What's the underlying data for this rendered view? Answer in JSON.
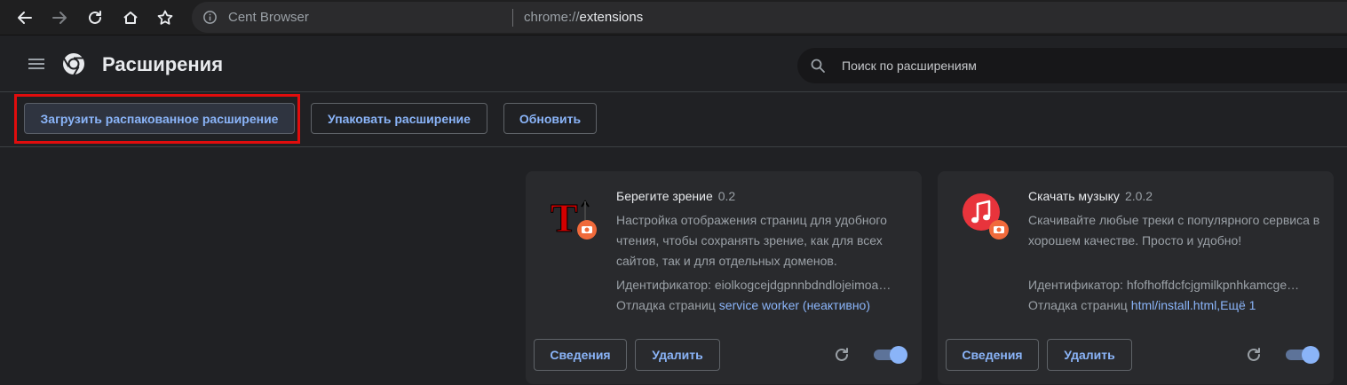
{
  "browser": {
    "site_name": "Cent Browser",
    "url_scheme": "chrome://",
    "url_host": "extensions"
  },
  "header": {
    "title": "Расширения",
    "search_placeholder": "Поиск по расширениям"
  },
  "toolbar": {
    "load_unpacked": "Загрузить распакованное расширение",
    "pack": "Упаковать расширение",
    "update": "Обновить"
  },
  "extensions": [
    {
      "name": "Берегите зрение",
      "version": "0.2",
      "description": "Настройка отображения страниц для удобного чтения, чтобы сохранять зрение, как для всех сайтов, так и для отдельных доменов.",
      "id_label": "Идентификатор:",
      "id": "eiolkogcejdgpnnbdndlojeimoa…",
      "debug_label": "Отладка страниц",
      "debug_link": "service worker (неактивно)",
      "details": "Сведения",
      "remove": "Удалить",
      "enabled": true,
      "icon": "text-size-icon"
    },
    {
      "name": "Скачать музыку",
      "version": "2.0.2",
      "description": "Скачивайте любые треки с популярного сервиса в хорошем качестве. Просто и удобно!",
      "id_label": "Идентификатор:",
      "id": "hfofhoffdcfcjgmilkpnhkamcge…",
      "debug_label": "Отладка страниц",
      "debug_link": "html/install.html,Ещё 1",
      "details": "Сведения",
      "remove": "Удалить",
      "enabled": true,
      "icon": "music-note-icon"
    }
  ],
  "colors": {
    "accent": "#8ab4f8",
    "background": "#202124",
    "card": "#292a2d",
    "highlight": "#e00d0d"
  }
}
